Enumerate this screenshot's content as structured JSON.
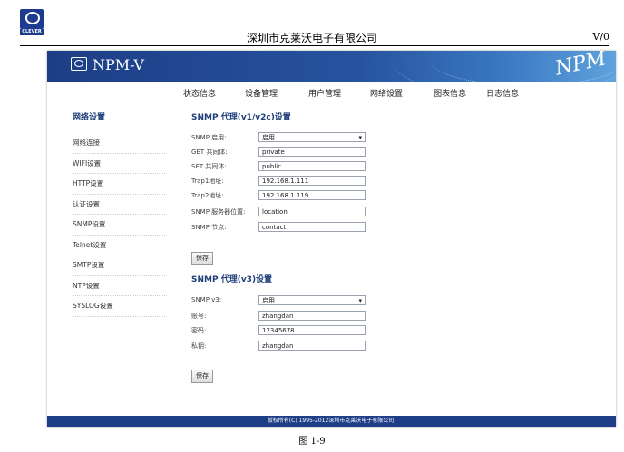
{
  "doc": {
    "brand": "CLEVER",
    "company": "深圳市克莱沃电子有限公司",
    "version": "V/0",
    "caption": "图 1-9"
  },
  "app": {
    "product": "NPM-V",
    "brand_graphic": "NPM",
    "nav": [
      "状态信息",
      "设备管理",
      "用户管理",
      "网络设置",
      "图表信息",
      "日志信息"
    ],
    "sidebar": {
      "heading": "网络设置",
      "items": [
        "网络连接",
        "WIFI设置",
        "HTTP设置",
        "认证设置",
        "SNMP设置",
        "Telnet设置",
        "SMTP设置",
        "NTP设置",
        "SYSLOG设置"
      ]
    },
    "v1v2c": {
      "title": "SNMP 代理(v1/v2c)设置",
      "fields": [
        {
          "label": "SNMP 启用:",
          "value": "启用",
          "type": "select"
        },
        {
          "label": "GET 共同体:",
          "value": "private",
          "type": "text"
        },
        {
          "label": "SET 共同体:",
          "value": "public",
          "type": "text"
        },
        {
          "label": "Trap1地址:",
          "value": "192.168.1.111",
          "type": "text"
        },
        {
          "label": "Trap2地址:",
          "value": "192.168.1.119",
          "type": "text"
        },
        {
          "label": "SNMP 服务器位置:",
          "value": "location",
          "type": "text"
        },
        {
          "label": "SNMP 节点:",
          "value": "contact",
          "type": "text"
        }
      ],
      "save_label": "保存"
    },
    "v3": {
      "title": "SNMP 代理(v3)设置",
      "fields": [
        {
          "label": "SNMP v3:",
          "value": "启用",
          "type": "select"
        },
        {
          "label": "账号:",
          "value": "zhangdan",
          "type": "text"
        },
        {
          "label": "密码:",
          "value": "12345678",
          "type": "text"
        },
        {
          "label": "私钥:",
          "value": "zhangdan",
          "type": "text"
        }
      ],
      "save_label": "保存"
    },
    "footer": "版权所有(C) 1995-2012深圳市克莱沃电子有限公司."
  }
}
